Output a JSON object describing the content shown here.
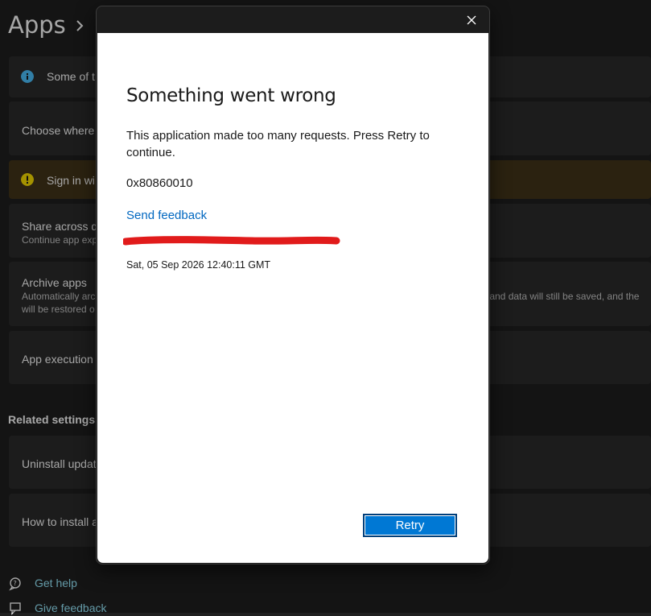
{
  "background": {
    "page_title": "Apps",
    "cards": [
      {
        "title": "Some of t"
      },
      {
        "title": "Choose where"
      },
      {
        "title": "Sign in wi"
      },
      {
        "title": "Share across de",
        "subtitle": "Continue app exp"
      },
      {
        "title": "Archive apps",
        "subtitle_line1": "Automatically arc",
        "subtitle_line1_right": "s and data will still be saved, and the",
        "subtitle_line2": "will be restored o"
      },
      {
        "title": "App execution"
      }
    ],
    "related_settings": {
      "heading": "Related settings",
      "items": [
        {
          "title": "Uninstall updat"
        },
        {
          "title": "How to install a"
        }
      ]
    },
    "help_links": {
      "get_help": "Get help",
      "give_feedback": "Give feedback"
    },
    "colors": {
      "info": "#4cc2ff",
      "warning": "#fce100"
    }
  },
  "dialog": {
    "title": "Something went wrong",
    "message": "This application made too many requests. Press Retry to continue.",
    "error_code": "0x80860010",
    "send_feedback": "Send feedback",
    "timestamp": "Sat, 05 Sep 2026 12:40:11 GMT",
    "retry_label": "Retry",
    "close_icon": "close-icon",
    "accent": "#0078d4",
    "redaction_color": "#e11b1b"
  }
}
